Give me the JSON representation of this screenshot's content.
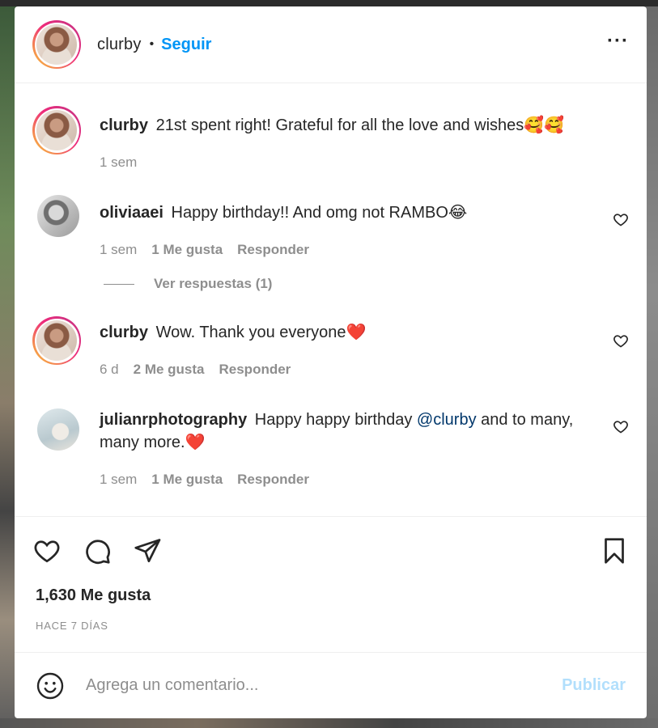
{
  "post": {
    "author": "clurby",
    "follow_label": "Seguir",
    "dot": "•",
    "more_label": "···"
  },
  "comments": [
    {
      "username": "clurby",
      "text": "21st spent right! Grateful for all the love and wishes🥰🥰",
      "time": "1 sem",
      "is_caption": true
    },
    {
      "username": "oliviaaei",
      "text": "Happy birthday!! And omg not RAMBO😂",
      "time": "1 sem",
      "likes": "1 Me gusta",
      "reply": "Responder",
      "view_replies": "Ver respuestas (1)"
    },
    {
      "username": "clurby",
      "text": "Wow. Thank you everyone❤️",
      "time": "6 d",
      "likes": "2 Me gusta",
      "reply": "Responder"
    },
    {
      "username": "julianrphotography",
      "text_before": "Happy happy birthday ",
      "mention": "@clurby",
      "text_after": " and to many, many more.❤️",
      "time": "1 sem",
      "likes": "1 Me gusta",
      "reply": "Responder"
    }
  ],
  "stats": {
    "likes": "1,630 Me gusta",
    "time_ago": "HACE 7 DÍAS"
  },
  "composer": {
    "placeholder": "Agrega un comentario...",
    "publish_label": "Publicar"
  },
  "colors": {
    "accent": "#0095f6",
    "publish_disabled": "#b2dffc",
    "secondary_text": "#8e8e8e",
    "mention": "#00376b"
  },
  "icons": [
    "more-options-icon",
    "heart-icon",
    "comment-icon",
    "share-icon",
    "save-icon",
    "emoji-icon"
  ]
}
